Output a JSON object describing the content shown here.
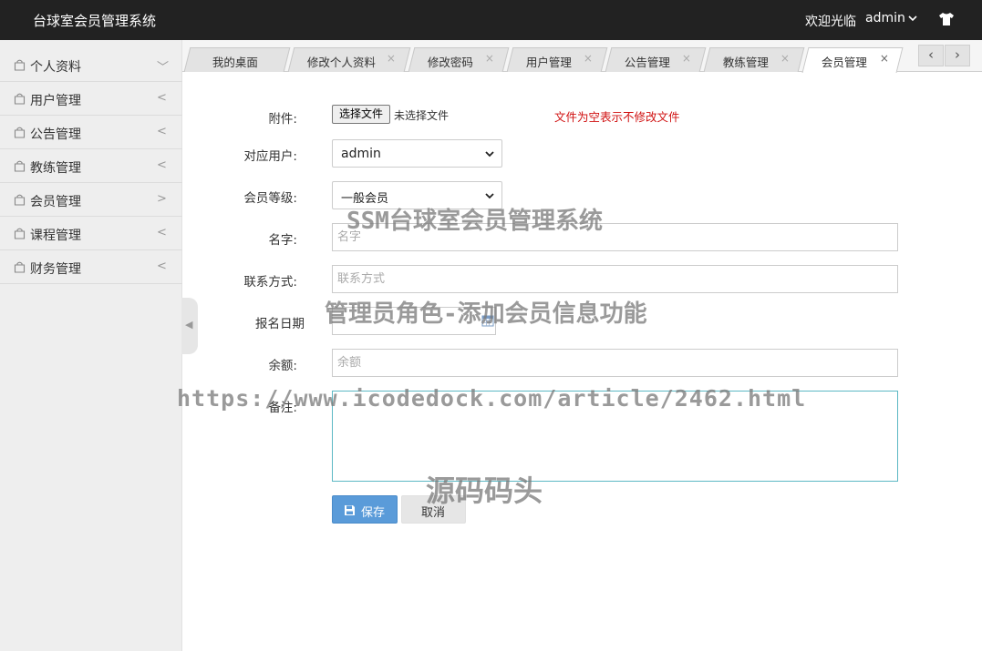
{
  "header": {
    "title": "台球室会员管理系统",
    "welcome": "欢迎光临",
    "user": "admin",
    "icons": [
      "chevron-down-icon",
      "tshirt-icon"
    ]
  },
  "sidebar": {
    "items": [
      {
        "label": "个人资料",
        "arrow": "﹀"
      },
      {
        "label": "用户管理",
        "arrow": "<"
      },
      {
        "label": "公告管理",
        "arrow": "<"
      },
      {
        "label": "教练管理",
        "arrow": "<"
      },
      {
        "label": "会员管理",
        "arrow": ">"
      },
      {
        "label": "课程管理",
        "arrow": "<"
      },
      {
        "label": "财务管理",
        "arrow": "<"
      }
    ]
  },
  "tabs": [
    {
      "label": "我的桌面",
      "closable": false
    },
    {
      "label": "修改个人资料",
      "closable": true
    },
    {
      "label": "修改密码",
      "closable": true
    },
    {
      "label": "用户管理",
      "closable": true
    },
    {
      "label": "公告管理",
      "closable": true
    },
    {
      "label": "教练管理",
      "closable": true
    },
    {
      "label": "会员管理",
      "closable": true,
      "active": true
    }
  ],
  "tab_nav": {
    "prev": "‹",
    "next": "›",
    "close": "×"
  },
  "form": {
    "attachment_label": "附件:",
    "file_button": "选择文件",
    "file_status": "未选择文件",
    "file_hint": "文件为空表示不修改文件",
    "user_label": "对应用户:",
    "user_value": "admin",
    "level_label": "会员等级:",
    "level_value": "一般会员",
    "name_label": "名字:",
    "name_placeholder": "名字",
    "contact_label": "联系方式:",
    "contact_placeholder": "联系方式",
    "date_label": "报名日期",
    "balance_label": "余额:",
    "balance_placeholder": "余额",
    "remark_label": "备注:",
    "save": "保存",
    "cancel": "取消"
  },
  "watermarks": {
    "line1": "SSM台球室会员管理系统",
    "line2": "管理员角色-添加会员信息功能",
    "line3": "https://www.icodedock.com/article/2462.html",
    "line4": "源码码头"
  },
  "colors": {
    "header_bg": "#222222",
    "accent": "#5a9bd9",
    "hint": "#d01010",
    "textarea_border": "#5cb8c4"
  }
}
